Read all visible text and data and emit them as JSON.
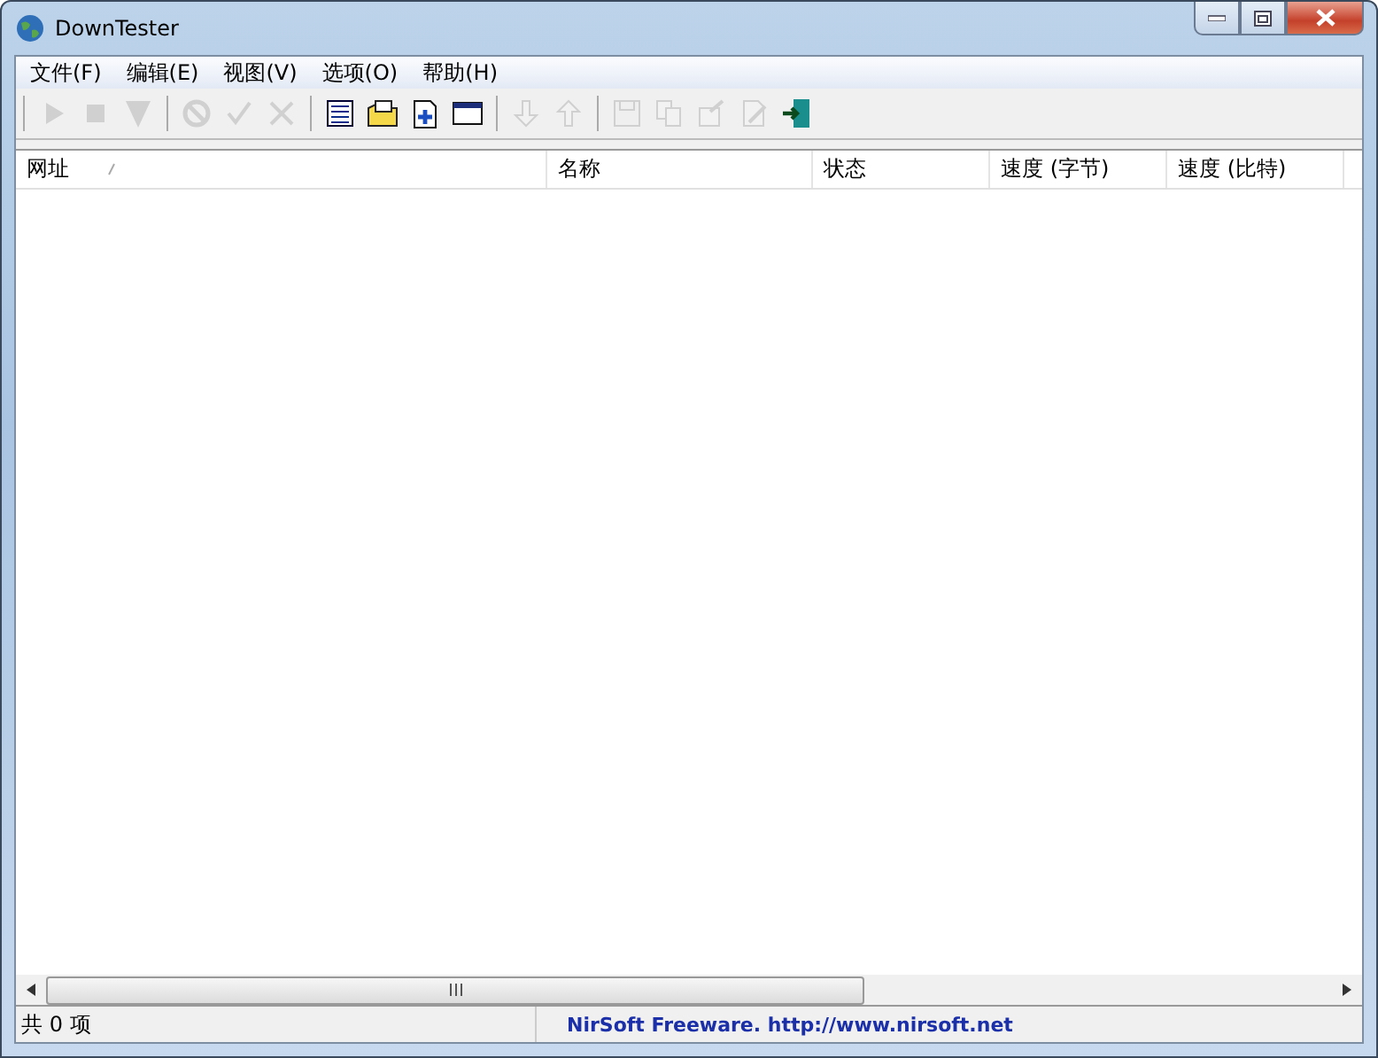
{
  "window": {
    "title": "DownTester"
  },
  "menu": [
    "文件(F)",
    "编辑(E)",
    "视图(V)",
    "选项(O)",
    "帮助(H)"
  ],
  "toolbar": [
    [
      {
        "disabled": true
      },
      {
        "disabled": true
      },
      {
        "disabled": true
      }
    ],
    [
      {
        "disabled": true
      },
      {
        "disabled": true
      },
      {
        "disabled": true
      }
    ],
    [
      {
        "disabled": false
      },
      {
        "disabled": false
      },
      {
        "disabled": false
      },
      {
        "disabled": false
      }
    ],
    [
      {
        "disabled": true
      },
      {
        "disabled": true
      }
    ],
    [
      {
        "disabled": true
      },
      {
        "disabled": true
      },
      {
        "disabled": true
      },
      {
        "disabled": true
      },
      {
        "disabled": false
      }
    ]
  ],
  "table": {
    "columns": [
      {
        "label": "网址",
        "sorted": true
      },
      {
        "label": "名称",
        "sorted": false
      },
      {
        "label": "状态",
        "sorted": false
      },
      {
        "label": "速度 (字节)",
        "sorted": false
      },
      {
        "label": "速度 (比特)",
        "sorted": false
      }
    ]
  },
  "status_bar": {
    "count": "共 0 项",
    "credit": "NirSoft Freeware.  http://www.nirsoft.net"
  }
}
